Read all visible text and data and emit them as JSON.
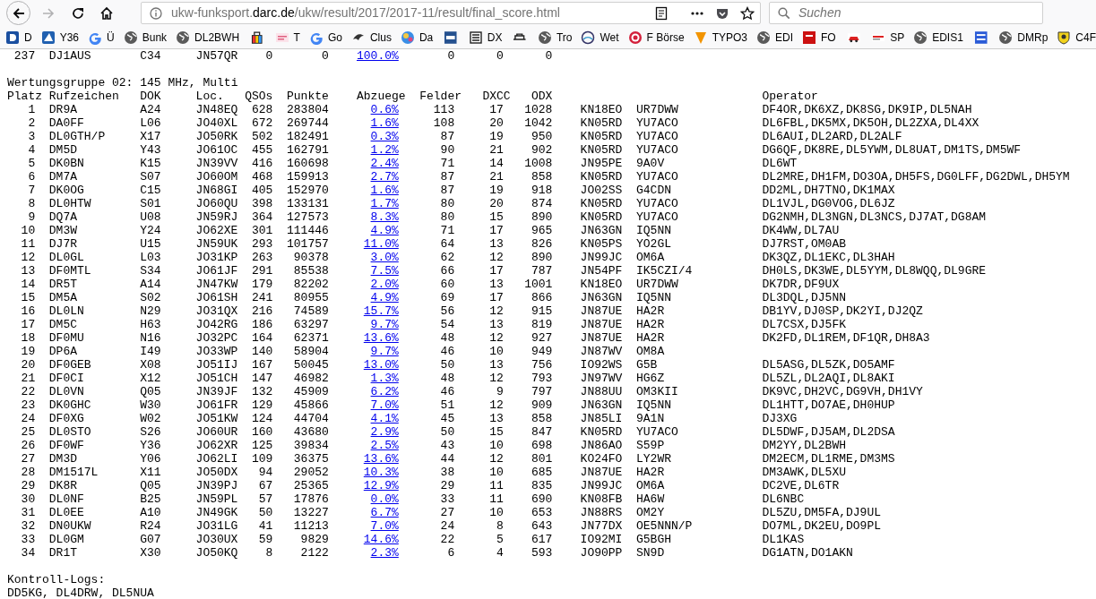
{
  "browser": {
    "url": "ukw-funksport.**darc.de**/ukw/result/2017/2017-11/result/final_score.html",
    "search": {
      "placeholder": "Suchen"
    }
  },
  "bookmarks": [
    {
      "label": "D"
    },
    {
      "label": "Y36"
    },
    {
      "label": "Ü"
    },
    {
      "label": "Bunk"
    },
    {
      "label": "DL2BWH"
    },
    {
      "kind": "icon"
    },
    {
      "label": "T"
    },
    {
      "label": "Go"
    },
    {
      "label": "Clus"
    },
    {
      "label": "Da"
    },
    {
      "kind": "icon"
    },
    {
      "label": "DX"
    },
    {
      "kind": "icon"
    },
    {
      "label": "Tro"
    },
    {
      "label": "Wet"
    },
    {
      "label": "F Börse"
    },
    {
      "label": "TYPO3"
    },
    {
      "label": "EDI"
    },
    {
      "label": "FO"
    },
    {
      "kind": "icon"
    },
    {
      "label": "SP"
    },
    {
      "label": "EDIS1"
    },
    {
      "kind": "icon"
    },
    {
      "label": "DMRp"
    },
    {
      "label": "C4F"
    }
  ],
  "previous_row": {
    "platz": "237",
    "call": "DJ1AUS",
    "dok": "C34",
    "loc": "JN57QR",
    "qsos": "0",
    "punkte": "0",
    "abzuege": "100.0%",
    "felder": "0",
    "dxcc": "0",
    "odx": "0"
  },
  "group_title": "Wertungsgruppe 02: 145 MHz, Multi",
  "columns": [
    "Platz",
    "Rufzeichen",
    "DOK",
    "Loc.",
    "QSOs",
    "Punkte",
    "Abzuege",
    "Felder",
    "DXCC",
    "ODX",
    "Operator"
  ],
  "rows": [
    {
      "platz": "1",
      "call": "DR9A",
      "dok": "A24",
      "loc": "JN48EQ",
      "qsos": "628",
      "punkte": "283804",
      "abzuege": "0.6%",
      "felder": "113",
      "dxcc": "17",
      "odx": "1028",
      "column_11": "KN18EO",
      "column_12": "UR7DWW",
      "operator": "DF4OR,DK6XZ,DK8SG,DK9IP,DL5NAH"
    },
    {
      "platz": "2",
      "call": "DA0FF",
      "dok": "L06",
      "loc": "JO40XL",
      "qsos": "672",
      "punkte": "269744",
      "abzuege": "1.6%",
      "felder": "108",
      "dxcc": "20",
      "odx": "1042",
      "column_11": "KN05RD",
      "column_12": "YU7ACO",
      "operator": "DL6FBL,DK5MX,DK5OH,DL2ZXA,DL4XX"
    },
    {
      "platz": "3",
      "call": "DL0GTH/P",
      "dok": "X17",
      "loc": "JO50RK",
      "qsos": "502",
      "punkte": "182491",
      "abzuege": "0.3%",
      "felder": "87",
      "dxcc": "19",
      "odx": "950",
      "column_11": "KN05RD",
      "column_12": "YU7ACO",
      "operator": "DL6AUI,DL2ARD,DL2ALF"
    },
    {
      "platz": "4",
      "call": "DM5D",
      "dok": "Y43",
      "loc": "JO61OC",
      "qsos": "455",
      "punkte": "162791",
      "abzuege": "1.2%",
      "felder": "90",
      "dxcc": "21",
      "odx": "902",
      "column_11": "KN05RD",
      "column_12": "YU7ACO",
      "operator": "DG6QF,DK8RE,DL5YWM,DL8UAT,DM1TS,DM5WF"
    },
    {
      "platz": "5",
      "call": "DK0BN",
      "dok": "K15",
      "loc": "JN39VV",
      "qsos": "416",
      "punkte": "160698",
      "abzuege": "2.4%",
      "felder": "71",
      "dxcc": "14",
      "odx": "1008",
      "column_11": "JN95PE",
      "column_12": "9A0V",
      "operator": "DL6WT"
    },
    {
      "platz": "6",
      "call": "DM7A",
      "dok": "S07",
      "loc": "JO60OM",
      "qsos": "468",
      "punkte": "159913",
      "abzuege": "2.7%",
      "felder": "87",
      "dxcc": "21",
      "odx": "858",
      "column_11": "KN05RD",
      "column_12": "YU7ACO",
      "operator": "DL2MRE,DH1FM,DO3OA,DH5FS,DG0LFF,DG2DWL,DH5YM"
    },
    {
      "platz": "7",
      "call": "DK0OG",
      "dok": "C15",
      "loc": "JN68GI",
      "qsos": "405",
      "punkte": "152970",
      "abzuege": "1.6%",
      "felder": "87",
      "dxcc": "19",
      "odx": "918",
      "column_11": "JO02SS",
      "column_12": "G4CDN",
      "operator": "DD2ML,DH7TNO,DK1MAX"
    },
    {
      "platz": "8",
      "call": "DL0HTW",
      "dok": "S01",
      "loc": "JO60QU",
      "qsos": "398",
      "punkte": "133131",
      "abzuege": "1.7%",
      "felder": "80",
      "dxcc": "20",
      "odx": "874",
      "column_11": "KN05RD",
      "column_12": "YU7ACO",
      "operator": "DL1VJL,DG0VOG,DL6JZ"
    },
    {
      "platz": "9",
      "call": "DQ7A",
      "dok": "U08",
      "loc": "JN59RJ",
      "qsos": "364",
      "punkte": "127573",
      "abzuege": "8.3%",
      "felder": "80",
      "dxcc": "15",
      "odx": "890",
      "column_11": "KN05RD",
      "column_12": "YU7ACO",
      "operator": "DG2NMH,DL3NGN,DL3NCS,DJ7AT,DG8AM"
    },
    {
      "platz": "10",
      "call": "DM3W",
      "dok": "Y24",
      "loc": "JO62XE",
      "qsos": "301",
      "punkte": "111446",
      "abzuege": "4.9%",
      "felder": "71",
      "dxcc": "17",
      "odx": "965",
      "column_11": "JN63GN",
      "column_12": "IQ5NN",
      "operator": "DK4WW,DL7AU"
    },
    {
      "platz": "11",
      "call": "DJ7R",
      "dok": "U15",
      "loc": "JN59UK",
      "qsos": "293",
      "punkte": "101757",
      "abzuege": "11.0%",
      "felder": "64",
      "dxcc": "13",
      "odx": "826",
      "column_11": "KN05PS",
      "column_12": "YO2GL",
      "operator": "DJ7RST,OM0AB"
    },
    {
      "platz": "12",
      "call": "DL0GL",
      "dok": "L03",
      "loc": "JO31KP",
      "qsos": "263",
      "punkte": "90378",
      "abzuege": "3.0%",
      "felder": "62",
      "dxcc": "12",
      "odx": "890",
      "column_11": "JN99JC",
      "column_12": "OM6A",
      "operator": "DK3QZ,DL1EKC,DL3HAH"
    },
    {
      "platz": "13",
      "call": "DF0MTL",
      "dok": "S34",
      "loc": "JO61JF",
      "qsos": "291",
      "punkte": "85538",
      "abzuege": "7.5%",
      "felder": "66",
      "dxcc": "17",
      "odx": "787",
      "column_11": "JN54PF",
      "column_12": "IK5CZI/4",
      "operator": "DH0LS,DK3WE,DL5YYM,DL8WQQ,DL9GRE"
    },
    {
      "platz": "14",
      "call": "DR5T",
      "dok": "A14",
      "loc": "JN47KW",
      "qsos": "179",
      "punkte": "82202",
      "abzuege": "2.0%",
      "felder": "60",
      "dxcc": "13",
      "odx": "1001",
      "column_11": "KN18EO",
      "column_12": "UR7DWW",
      "operator": "DK7DR,DF9UX"
    },
    {
      "platz": "15",
      "call": "DM5A",
      "dok": "S02",
      "loc": "JO61SH",
      "qsos": "241",
      "punkte": "80955",
      "abzuege": "4.9%",
      "felder": "69",
      "dxcc": "17",
      "odx": "866",
      "column_11": "JN63GN",
      "column_12": "IQ5NN",
      "operator": "DL3DQL,DJ5NN"
    },
    {
      "platz": "16",
      "call": "DL0LN",
      "dok": "N29",
      "loc": "JO31QX",
      "qsos": "216",
      "punkte": "74589",
      "abzuege": "15.7%",
      "felder": "56",
      "dxcc": "12",
      "odx": "915",
      "column_11": "JN87UE",
      "column_12": "HA2R",
      "operator": "DB1YV,DJ0SP,DK2YI,DJ2QZ"
    },
    {
      "platz": "17",
      "call": "DM5C",
      "dok": "H63",
      "loc": "JO42RG",
      "qsos": "186",
      "punkte": "63297",
      "abzuege": "9.7%",
      "felder": "54",
      "dxcc": "13",
      "odx": "819",
      "column_11": "JN87UE",
      "column_12": "HA2R",
      "operator": "DL7CSX,DJ5FK"
    },
    {
      "platz": "18",
      "call": "DF0MU",
      "dok": "N16",
      "loc": "JO32PC",
      "qsos": "164",
      "punkte": "62371",
      "abzuege": "13.6%",
      "felder": "48",
      "dxcc": "12",
      "odx": "927",
      "column_11": "JN87UE",
      "column_12": "HA2R",
      "operator": "DK2FD,DL1REM,DF1QR,DH8A3"
    },
    {
      "platz": "19",
      "call": "DP6A",
      "dok": "I49",
      "loc": "JO33WP",
      "qsos": "140",
      "punkte": "58904",
      "abzuege": "9.7%",
      "felder": "46",
      "dxcc": "10",
      "odx": "949",
      "column_11": "JN87WV",
      "column_12": "OM8A"
    },
    {
      "platz": "20",
      "call": "DF0GEB",
      "dok": "X08",
      "loc": "JO51IJ",
      "qsos": "167",
      "punkte": "50045",
      "abzuege": "13.0%",
      "felder": "50",
      "dxcc": "13",
      "odx": "756",
      "column_11": "IO92WS",
      "column_12": "G5B",
      "operator": "DL5ASG,DL5ZK,DO5AMF"
    },
    {
      "platz": "21",
      "call": "DF0CI",
      "dok": "X12",
      "loc": "JO51CH",
      "qsos": "147",
      "punkte": "46982",
      "abzuege": "1.3%",
      "felder": "48",
      "dxcc": "12",
      "odx": "793",
      "column_11": "JN97WV",
      "column_12": "HG6Z",
      "operator": "DL5ZL,DL2AQI,DL8AKI"
    },
    {
      "platz": "22",
      "call": "DL0VN",
      "dok": "Q05",
      "loc": "JN39JF",
      "qsos": "132",
      "punkte": "45909",
      "abzuege": "6.2%",
      "felder": "46",
      "dxcc": "9",
      "odx": "797",
      "column_11": "JN88UU",
      "column_12": "OM3KII",
      "operator": "DK9VC,DH2VC,DG9VH,DH1VY"
    },
    {
      "platz": "23",
      "call": "DK0GHC",
      "dok": "W30",
      "loc": "JO61FR",
      "qsos": "129",
      "punkte": "45866",
      "abzuege": "7.0%",
      "felder": "51",
      "dxcc": "12",
      "odx": "909",
      "column_11": "JN63GN",
      "column_12": "IQ5NN",
      "operator": "DL1HTT,DO7AE,DH0HUP"
    },
    {
      "platz": "24",
      "call": "DF0XG",
      "dok": "W02",
      "loc": "JO51KW",
      "qsos": "124",
      "punkte": "44704",
      "abzuege": "4.1%",
      "felder": "45",
      "dxcc": "13",
      "odx": "858",
      "column_11": "JN85LI",
      "column_12": "9A1N",
      "operator": "DJ3XG"
    },
    {
      "platz": "25",
      "call": "DL0STO",
      "dok": "S26",
      "loc": "JO60UR",
      "qsos": "160",
      "punkte": "43680",
      "abzuege": "2.9%",
      "felder": "50",
      "dxcc": "15",
      "odx": "847",
      "column_11": "KN05RD",
      "column_12": "YU7ACO",
      "operator": "DL5DWF,DJ5AM,DL2DSA"
    },
    {
      "platz": "26",
      "call": "DF0WF",
      "dok": "Y36",
      "loc": "JO62XR",
      "qsos": "125",
      "punkte": "39834",
      "abzuege": "2.5%",
      "felder": "43",
      "dxcc": "10",
      "odx": "698",
      "column_11": "JN86AO",
      "column_12": "S59P",
      "operator": "DM2YY,DL2BWH"
    },
    {
      "platz": "27",
      "call": "DM3D",
      "dok": "Y06",
      "loc": "JO62LI",
      "qsos": "109",
      "punkte": "36375",
      "abzuege": "13.6%",
      "felder": "44",
      "dxcc": "12",
      "odx": "801",
      "column_11": "KO24FO",
      "column_12": "LY2WR",
      "operator": "DM2ECM,DL1RME,DM3MS"
    },
    {
      "platz": "28",
      "call": "DM1517L",
      "dok": "X11",
      "loc": "JO50DX",
      "qsos": "94",
      "punkte": "29052",
      "abzuege": "10.3%",
      "felder": "38",
      "dxcc": "10",
      "odx": "685",
      "column_11": "JN87UE",
      "column_12": "HA2R",
      "operator": "DM3AWK,DL5XU"
    },
    {
      "platz": "29",
      "call": "DK8R",
      "dok": "Q05",
      "loc": "JN39PJ",
      "qsos": "67",
      "punkte": "25365",
      "abzuege": "12.9%",
      "felder": "29",
      "dxcc": "11",
      "odx": "835",
      "column_11": "JN99JC",
      "column_12": "OM6A",
      "operator": "DC2VE,DL6TR"
    },
    {
      "platz": "30",
      "call": "DL0NF",
      "dok": "B25",
      "loc": "JN59PL",
      "qsos": "57",
      "punkte": "17876",
      "abzuege": "0.0%",
      "felder": "33",
      "dxcc": "11",
      "odx": "690",
      "column_11": "KN08FB",
      "column_12": "HA6W",
      "operator": "DL6NBC"
    },
    {
      "platz": "31",
      "call": "DL0EE",
      "dok": "A10",
      "loc": "JN49GK",
      "qsos": "50",
      "punkte": "13227",
      "abzuege": "6.7%",
      "felder": "27",
      "dxcc": "10",
      "odx": "653",
      "column_11": "JN88RS",
      "column_12": "OM2Y",
      "operator": "DL5ZU,DM5FA,DJ9UL"
    },
    {
      "platz": "32",
      "call": "DN0UKW",
      "dok": "R24",
      "loc": "JO31LG",
      "qsos": "41",
      "punkte": "11213",
      "abzuege": "7.0%",
      "felder": "24",
      "dxcc": "8",
      "odx": "643",
      "column_11": "JN77DX",
      "column_12": "OE5NNN/P",
      "operator": "DO7ML,DK2EU,DO9PL"
    },
    {
      "platz": "33",
      "call": "DL0GM",
      "dok": "G07",
      "loc": "JO30UX",
      "qsos": "59",
      "punkte": "9829",
      "abzuege": "14.6%",
      "felder": "22",
      "dxcc": "5",
      "odx": "617",
      "column_11": "IO92MI",
      "column_12": "G5BGH",
      "operator": "DL1KAS"
    },
    {
      "platz": "34",
      "call": "DR1T",
      "dok": "X30",
      "loc": "JO50KQ",
      "qsos": "8",
      "punkte": "2122",
      "abzuege": "2.3%",
      "felder": "6",
      "dxcc": "4",
      "odx": "593",
      "column_11": "JO90PP",
      "column_12": "SN9D",
      "operator": "DG1ATN,DO1AKN"
    }
  ],
  "control_logs": {
    "title": "Kontroll-Logs:",
    "calls": "DD5KG, DL4DRW, DL5NUA"
  }
}
